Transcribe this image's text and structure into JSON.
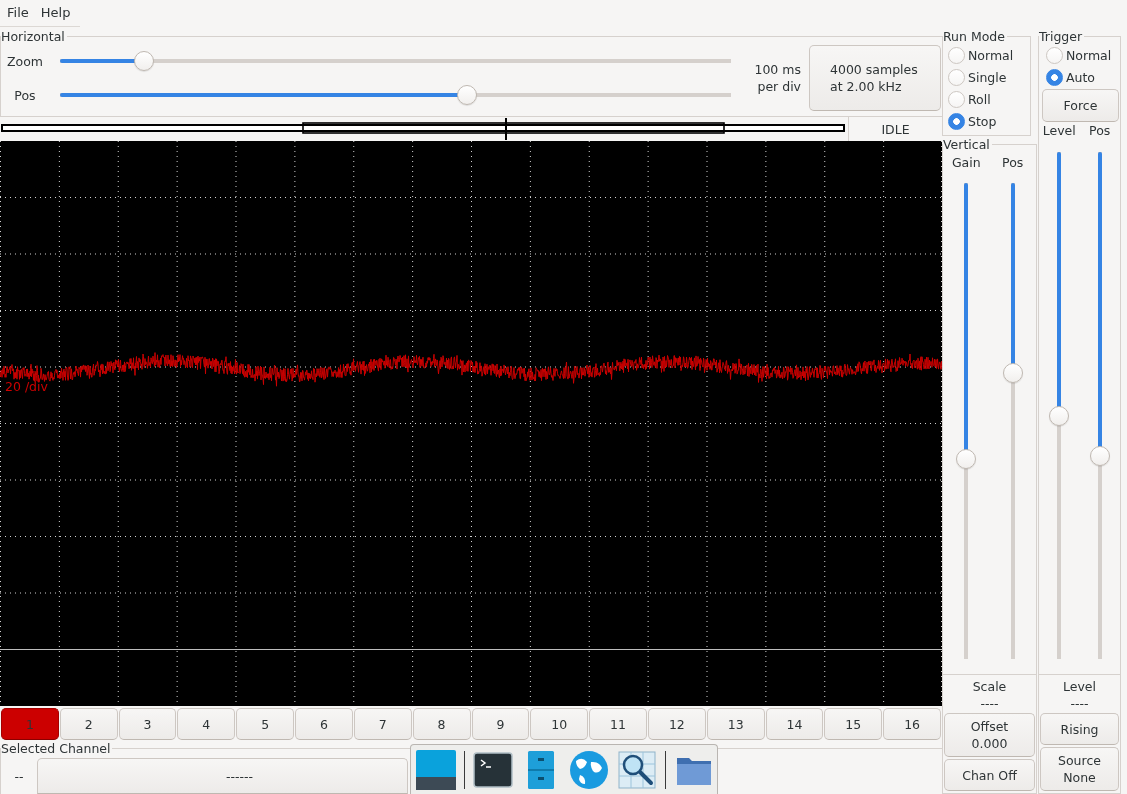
{
  "menu": [
    {
      "label": "File"
    },
    {
      "label": "Help"
    }
  ],
  "horizontal": {
    "title": "Horizontal",
    "sliders": [
      {
        "label": "Zoom",
        "level": 0.125
      },
      {
        "label": "Pos",
        "level": 0.607
      }
    ],
    "time_per_div": [
      "100 ms",
      "per div"
    ],
    "samples_button": [
      "4000 samples",
      "at 2.00 kHz"
    ]
  },
  "status": "IDLE",
  "display": {
    "scale_label": "20 /div"
  },
  "channel_buttons": [
    {
      "label": "1",
      "selected": true
    },
    {
      "label": "2",
      "selected": false
    },
    {
      "label": "3",
      "selected": false
    },
    {
      "label": "4",
      "selected": false
    },
    {
      "label": "5",
      "selected": false
    },
    {
      "label": "6",
      "selected": false
    },
    {
      "label": "7",
      "selected": false
    },
    {
      "label": "8",
      "selected": false
    },
    {
      "label": "9",
      "selected": false
    },
    {
      "label": "10",
      "selected": false
    },
    {
      "label": "11",
      "selected": false
    },
    {
      "label": "12",
      "selected": false
    },
    {
      "label": "13",
      "selected": false
    },
    {
      "label": "14",
      "selected": false
    },
    {
      "label": "15",
      "selected": false
    },
    {
      "label": "16",
      "selected": false
    }
  ],
  "selected_channel": {
    "title": "Selected Channel",
    "value": "--",
    "button": "------"
  },
  "run_mode": {
    "title": "Run Mode",
    "options": [
      {
        "label": "Normal",
        "selected": false
      },
      {
        "label": "Single",
        "selected": false
      },
      {
        "label": "Roll",
        "selected": false
      },
      {
        "label": "Stop",
        "selected": true
      }
    ]
  },
  "vertical": {
    "title": "Vertical",
    "sliders": [
      {
        "label": "Gain",
        "level": 0.58
      },
      {
        "label": "Pos",
        "level": 0.4
      }
    ],
    "readout_label": "Scale",
    "readout_value": "----",
    "buttons": [
      {
        "lines": [
          "Offset",
          "0.000"
        ]
      },
      {
        "lines": [
          "Chan Off"
        ]
      }
    ]
  },
  "trigger": {
    "title": "Trigger",
    "options": [
      {
        "label": "Normal",
        "selected": false
      },
      {
        "label": "Auto",
        "selected": true
      }
    ],
    "force_button": "Force",
    "sliders": [
      {
        "label": "Level",
        "level": 0.52
      },
      {
        "label": "Pos",
        "level": 0.6
      }
    ],
    "readout_label": "Level",
    "readout_value": "----",
    "buttons": [
      {
        "lines": [
          "Rising"
        ]
      },
      {
        "lines": [
          "Source",
          "None"
        ]
      }
    ]
  }
}
